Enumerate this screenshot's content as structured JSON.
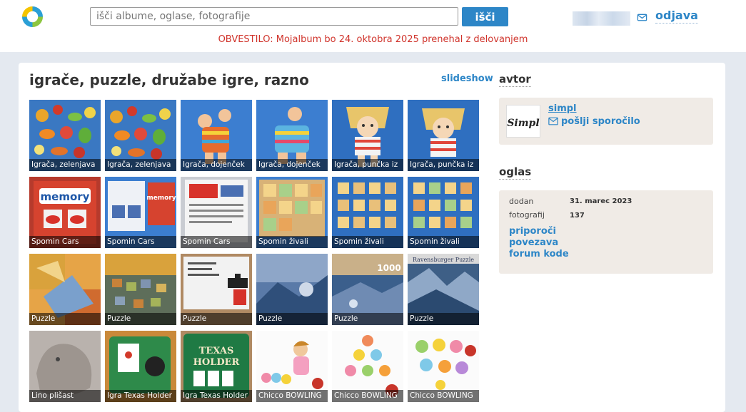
{
  "header": {
    "search": {
      "placeholder": "išči albume, oglase, fotografije",
      "value": ""
    },
    "search_button_label": "išči",
    "notice": "OBVESTILO: Mojalbum bo 24. oktobra 2025 prenehal z delovanjem",
    "logout_label": "odjava",
    "icons": {
      "logo": "mojalbum-logo",
      "mail": "mail-icon"
    },
    "colors": {
      "accent": "#2d86c7",
      "notice": "#d0342c"
    }
  },
  "album": {
    "title": "igrače, puzzle, družabe igre, razno",
    "slideshow_label": "slideshow",
    "photos": [
      {
        "caption": "Igrača, zelenjava"
      },
      {
        "caption": "Igrača, zelenjava"
      },
      {
        "caption": "Igrača, dojenček"
      },
      {
        "caption": "Igrača, dojenček"
      },
      {
        "caption": "Igrača, punčka iz"
      },
      {
        "caption": "Igrača, punčka iz"
      },
      {
        "caption": "Spomin Cars"
      },
      {
        "caption": "Spomin Cars"
      },
      {
        "caption": "Spomin Cars"
      },
      {
        "caption": "Spomin živali"
      },
      {
        "caption": "Spomin živali"
      },
      {
        "caption": "Spomin živali"
      },
      {
        "caption": "Puzzle"
      },
      {
        "caption": "Puzzle"
      },
      {
        "caption": "Puzzle"
      },
      {
        "caption": "Puzzle"
      },
      {
        "caption": "Puzzle"
      },
      {
        "caption": "Puzzle"
      },
      {
        "caption": "Lino plišast"
      },
      {
        "caption": "Igra Texas Holder"
      },
      {
        "caption": "Igra Texas Holder"
      },
      {
        "caption": "Chicco BOWLING"
      },
      {
        "caption": "Chicco BOWLING"
      },
      {
        "caption": "Chicco BOWLING"
      }
    ]
  },
  "sidebar": {
    "author": {
      "heading": "avtor",
      "name": "simpl",
      "avatar_text": "Simpl",
      "send_message_label": "pošlji sporočilo"
    },
    "ad": {
      "heading": "oglas",
      "added_label": "dodan",
      "added_value": "31. marec 2023",
      "photos_label": "fotografij",
      "photos_value": "137",
      "links": [
        "priporoči",
        "povezava",
        "forum kode"
      ]
    }
  }
}
